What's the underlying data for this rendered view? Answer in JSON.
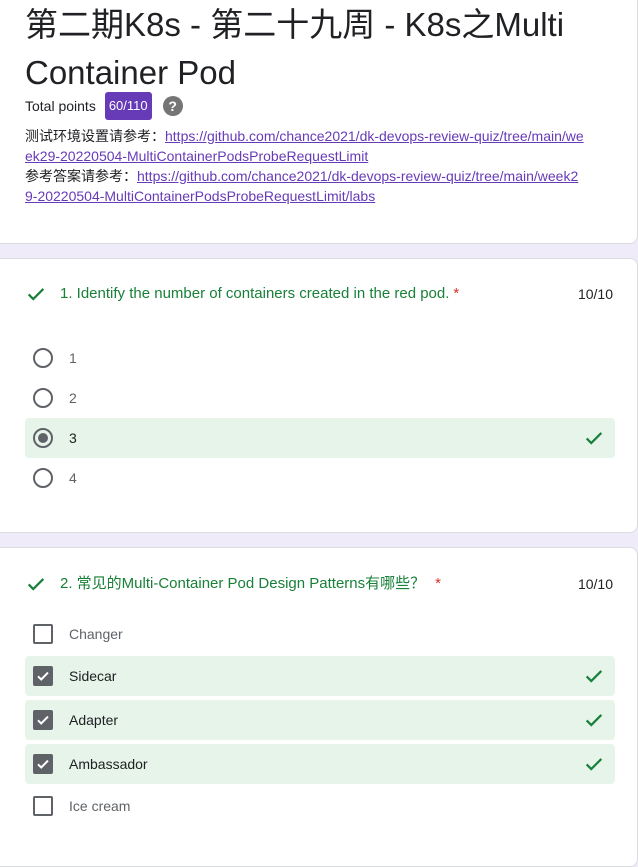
{
  "form": {
    "title": "第二期K8s - 第二十九周 - K8s之Multi Container Pod",
    "total_points_label": "Total points",
    "score_badge": "60/110",
    "help_glyph": "?",
    "desc_line1_prefix": "测试环境设置请参考：",
    "desc_line1_link": "https://github.com/chance2021/dk-devops-review-quiz/tree/main/week29-20220504-MultiContainerPodsProbeRequestLimit",
    "desc_line2_prefix": "参考答案请参考：",
    "desc_line2_link": "https://github.com/chance2021/dk-devops-review-quiz/tree/main/week29-20220504-MultiContainerPodsProbeRequestLimit/labs"
  },
  "q1": {
    "title": "1. Identify the number of containers created in the red pod.",
    "required_mark": "*",
    "score": "10/10",
    "options": [
      "1",
      "2",
      "3",
      "4"
    ],
    "selected_index": 2
  },
  "q2": {
    "title": "2. 常见的Multi-Container Pod Design Patterns有哪些？",
    "required_mark": "*",
    "score": "10/10",
    "options": [
      "Changer",
      "Sidecar",
      "Adapter",
      "Ambassador",
      "Ice cream"
    ],
    "checked": [
      false,
      true,
      true,
      true,
      false
    ]
  },
  "colors": {
    "accent": "#673ab7",
    "correct_green": "#188038",
    "correct_bg": "#e6f4ea",
    "page_bg": "#f0ebf8"
  },
  "icons": {
    "correct": "check-icon",
    "help": "help-icon"
  }
}
